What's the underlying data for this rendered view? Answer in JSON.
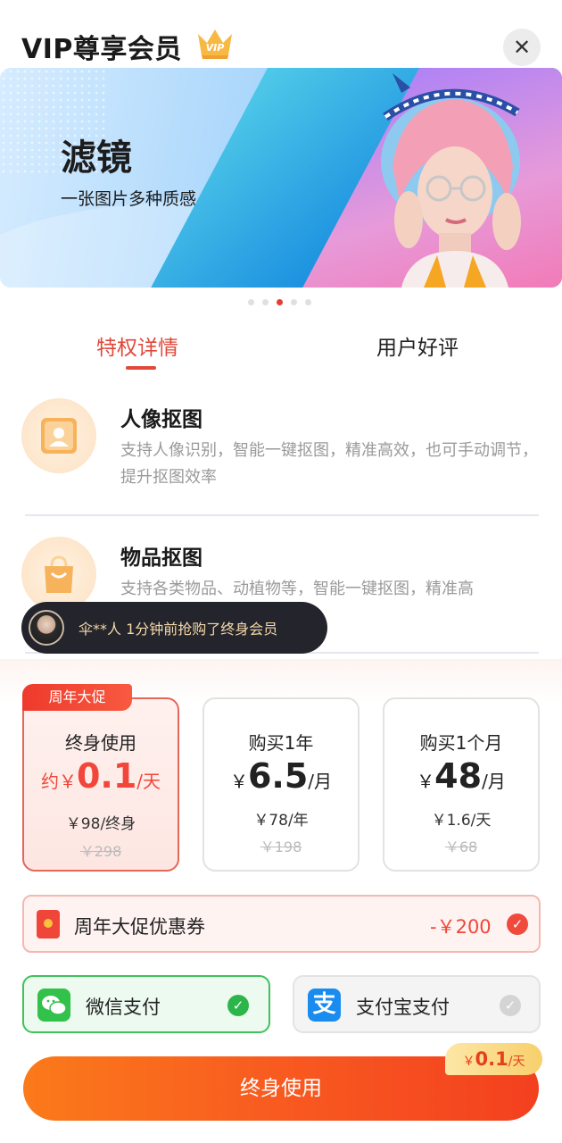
{
  "header": {
    "title": "VIP尊享会员",
    "badge_text": "VIP",
    "close_symbol": "✕"
  },
  "banner": {
    "title": "滤镜",
    "subtitle": "一张图片多种质感",
    "slide_count": 5,
    "active_slide_index": 2
  },
  "tabs": [
    {
      "label": "特权详情",
      "active": true
    },
    {
      "label": "用户好评",
      "active": false
    }
  ],
  "features": [
    {
      "title": "人像抠图",
      "desc": "支持人像识别，智能一键抠图，精准高效，也可手动调节，提升抠图效率",
      "icon": "portrait-icon"
    },
    {
      "title": "物品抠图",
      "desc": "支持各类物品、动植物等，智能一键抠图，精准高",
      "icon": "shopping-bag-icon"
    }
  ],
  "toast": {
    "text": "伞**人  1分钟前抢购了终身会员"
  },
  "promo_tag": "周年大促",
  "plans": [
    {
      "name": "终身使用",
      "prefix": "约￥",
      "price": "0.1",
      "unit": "/天",
      "detail": "￥98/终身",
      "original": "￥298",
      "selected": true
    },
    {
      "name": "购买1年",
      "prefix": "￥",
      "price": "6.5",
      "unit": "/月",
      "detail": "￥78/年",
      "original": "￥198",
      "selected": false
    },
    {
      "name": "购买1个月",
      "prefix": "￥",
      "price": "48",
      "unit": "/月",
      "detail": "￥1.6/天",
      "original": "￥68",
      "selected": false
    }
  ],
  "coupon": {
    "label": "周年大促优惠券",
    "amount": "-￥200",
    "checked": true
  },
  "payment": [
    {
      "label": "微信支付",
      "selected": true,
      "icon": "wechat-icon"
    },
    {
      "label": "支付宝支付",
      "selected": false,
      "icon": "alipay-icon",
      "icon_char": "支"
    }
  ],
  "cta": {
    "label": "终身使用",
    "badge_prefix": "￥",
    "badge_price": "0.1",
    "badge_unit": "/天"
  },
  "colors": {
    "accent_red": "#f2463a",
    "wechat_green": "#3fc15b",
    "alipay_blue": "#1a8cf0",
    "cta_orange": "#f85a20",
    "toast_text": "#f5d9a8"
  }
}
